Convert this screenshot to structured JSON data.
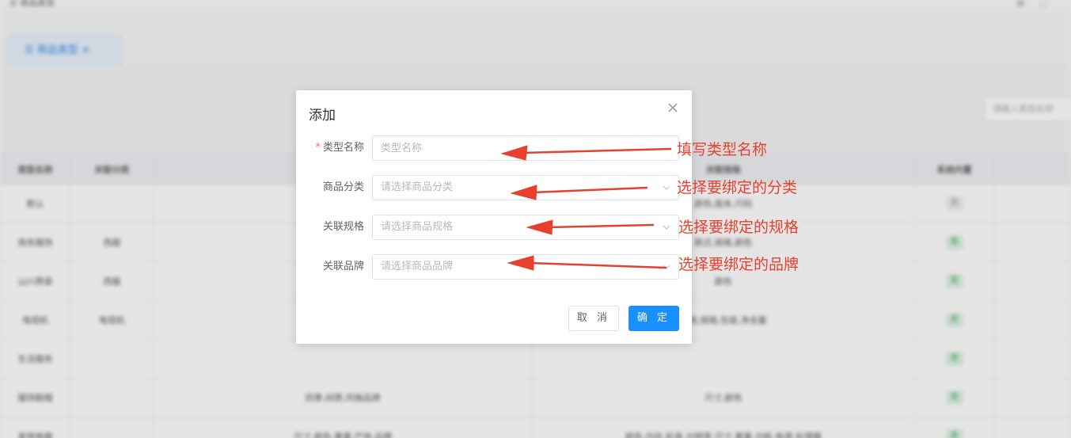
{
  "background": {
    "breadcrumb": "☰ 商品类型",
    "tab_label": "☰ 商品类型 ×",
    "search_placeholder": "请输入类型名称",
    "table": {
      "headers": [
        "类型名称",
        "关联分类",
        "",
        "关联规格",
        "系统内置"
      ],
      "rows": [
        [
          "默认",
          "",
          "",
          "颜色,版本,尺码",
          "否"
        ],
        [
          "商务服饰",
          "西服",
          "",
          "款式,规格,颜色",
          "是"
        ],
        [
          "山川男装",
          "西服",
          "",
          "颜色",
          "是"
        ],
        [
          "电视机",
          "电视机",
          "",
          "产地,规格,包装,净含量",
          "是"
        ],
        [
          "生活服务",
          "",
          "",
          "",
          "是"
        ],
        [
          "服饰鞋帽",
          "",
          "四季,材质,风格品牌",
          "尺寸,颜色",
          "是"
        ],
        [
          "家用电器",
          "",
          "尺寸,颜色,重量,产地,品牌",
          "颜色,内存,机身,分辨率,尺寸,重量,功耗,电源,处理器",
          "是"
        ]
      ]
    }
  },
  "dialog": {
    "title": "添加",
    "fields": {
      "type_name": {
        "label": "类型名称",
        "required_mark": "*",
        "placeholder": "类型名称",
        "value": ""
      },
      "category": {
        "label": "商品分类",
        "placeholder": "请选择商品分类"
      },
      "spec": {
        "label": "关联规格",
        "placeholder": "请选择商品规格"
      },
      "brand": {
        "label": "关联品牌",
        "placeholder": "请选择商品品牌"
      }
    },
    "cancel_label": "取 消",
    "ok_label": "确 定"
  },
  "annotations": [
    "填写类型名称",
    "选择要绑定的分类",
    "选择要绑定的规格",
    "选择要绑定的品牌"
  ],
  "colors": {
    "primary": "#1890ff",
    "annotation": "#e8402f",
    "required": "#f56c6c"
  }
}
